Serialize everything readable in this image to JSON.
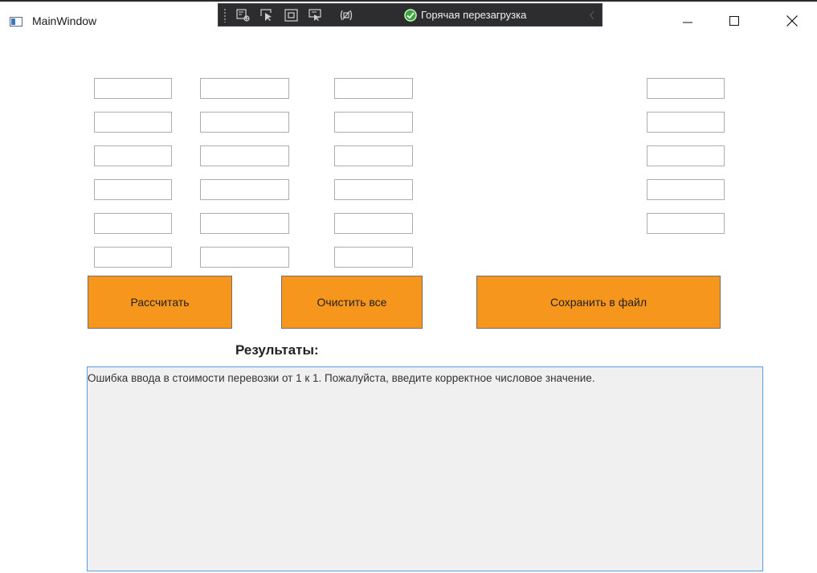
{
  "window": {
    "title": "MainWindow",
    "controls": [
      "minimize",
      "maximize",
      "close"
    ]
  },
  "devtoolbar": {
    "icons": [
      "select-element-icon",
      "pointer-icon",
      "layout-adorner-icon",
      "track-focus-icon",
      "binding-failures-icon"
    ],
    "hot_reload_label": "Горячая перезагрузка",
    "hot_reload_status": "ok"
  },
  "inputs": {
    "column_a": [
      "",
      "",
      "",
      "",
      "",
      ""
    ],
    "column_b": [
      "",
      "",
      "",
      "",
      "",
      ""
    ],
    "column_c": [
      "",
      "",
      "",
      "",
      "",
      ""
    ],
    "column_d": [
      "",
      "",
      "",
      "",
      ""
    ]
  },
  "buttons": {
    "calculate": "Рассчитать",
    "clear_all": "Очистить все",
    "save_to_file": "Сохранить в файл"
  },
  "results": {
    "label": "Результаты:",
    "text": "Ошибка ввода в стоимости перевозки от 1 к 1. Пожалуйста, введите корректное числовое значение."
  },
  "colors": {
    "button_bg": "#f7961c",
    "results_bg": "#f0f0f0",
    "results_border": "#569de5",
    "toolbar_bg": "#2d2d30"
  }
}
